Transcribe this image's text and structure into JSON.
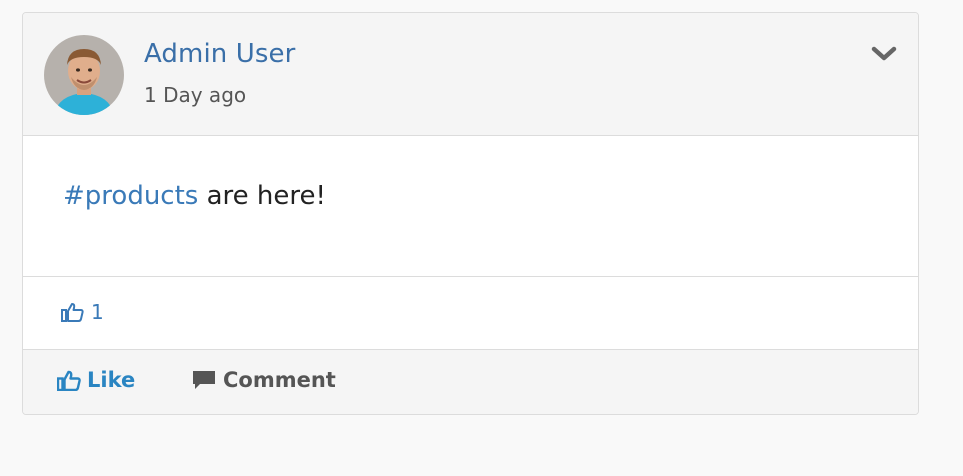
{
  "post": {
    "author": "Admin User",
    "timestamp": "1 Day ago",
    "hashtag": "#products",
    "text": " are here!",
    "like_count": "1"
  },
  "actions": {
    "like_label": "Like",
    "comment_label": "Comment"
  },
  "colors": {
    "link": "#3a7ab8",
    "like_action": "#2a85c2",
    "muted": "#555555",
    "header_bg": "#f5f5f5",
    "border": "#dcdcdc"
  },
  "icons": {
    "menu": "chevron-down-icon",
    "like": "thumbs-up-icon",
    "comment": "comment-icon"
  }
}
